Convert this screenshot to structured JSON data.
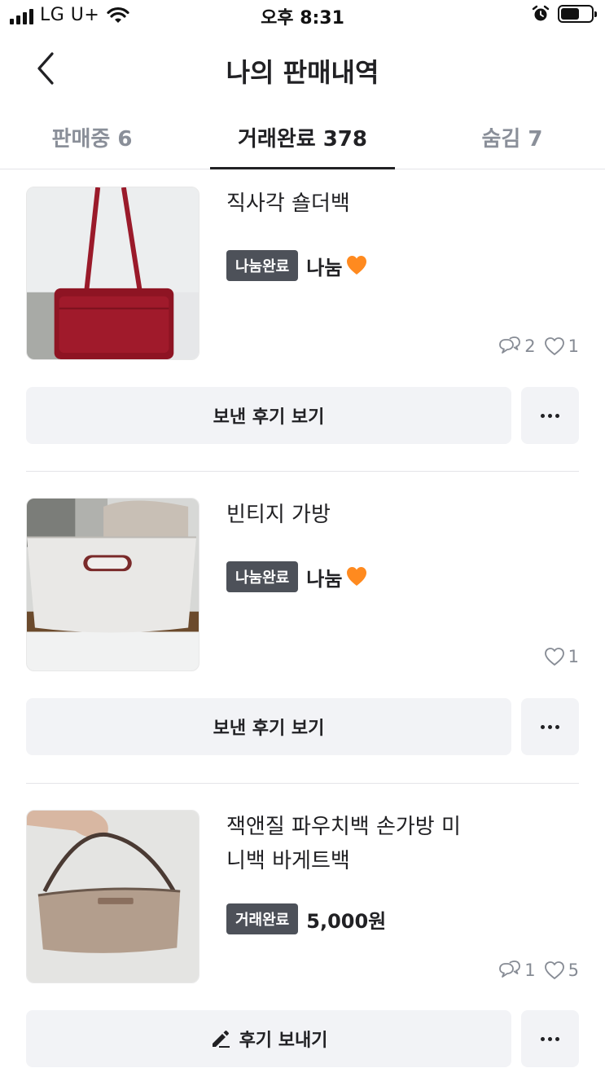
{
  "status_bar": {
    "carrier": "LG U+",
    "time": "오후 8:31"
  },
  "header": {
    "title": "나의 판매내역"
  },
  "tabs": [
    {
      "label": "판매중 6"
    },
    {
      "label": "거래완료 378"
    },
    {
      "label": "숨김 7"
    }
  ],
  "items": [
    {
      "title": "직사각 숄더백",
      "status_badge": "나눔완료",
      "price": "나눔",
      "price_icon": "orange-heart-icon",
      "chat_count": "2",
      "like_count": "1",
      "action_label": "보낸 후기 보기"
    },
    {
      "title": "빈티지 가방",
      "status_badge": "나눔완료",
      "price": "나눔",
      "price_icon": "orange-heart-icon",
      "like_count": "1",
      "action_label": "보낸 후기 보기"
    },
    {
      "title": "잭앤질 파우치백 손가방 미니백 바게트백",
      "status_badge": "거래완료",
      "price": "5,000원",
      "chat_count": "1",
      "like_count": "5",
      "action_label": "후기 보내기",
      "action_icon": "pencil-icon"
    }
  ],
  "colors": {
    "badge_bg": "#4d5159",
    "button_bg": "#f2f3f6",
    "active_tab": "#212124",
    "inactive_tab": "#8a8f99",
    "heart": "#ff8a1f"
  }
}
